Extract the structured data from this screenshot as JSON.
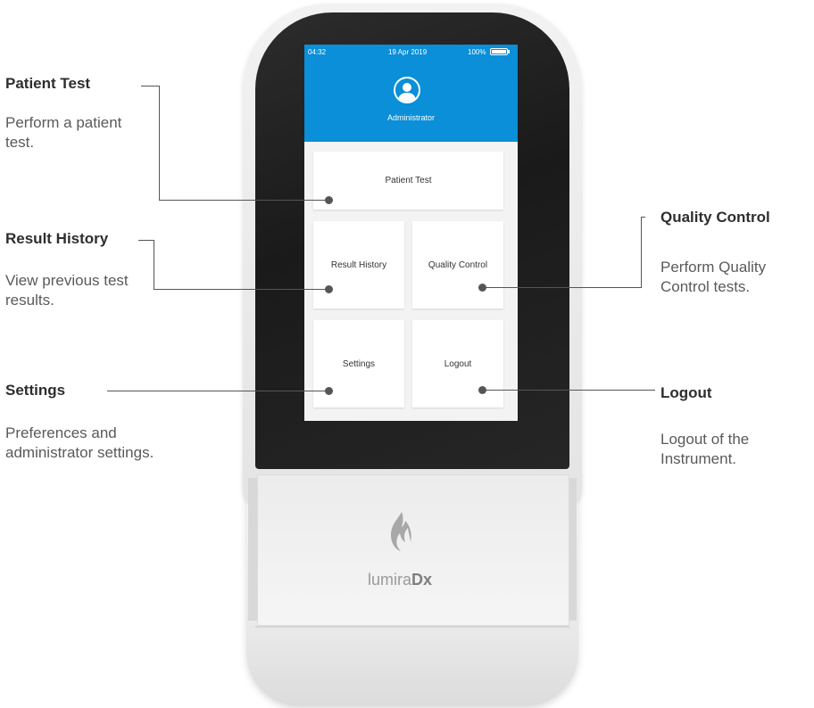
{
  "screen": {
    "status_bar": {
      "time": "04:32",
      "date": "19 Apr 2019",
      "battery": "100%"
    },
    "battery_level": 1.0,
    "user": {
      "name": "Administrator",
      "icon": "user-avatar-icon"
    },
    "tiles": {
      "patient_test": "Patient Test",
      "result_history": "Result History",
      "quality_control": "Quality Control",
      "settings": "Settings",
      "logout": "Logout"
    },
    "header_color": "#0a8fd8"
  },
  "callouts": {
    "patient_test": {
      "title": "Patient Test",
      "desc": "Perform a patient test."
    },
    "result_history": {
      "title": "Result History",
      "desc": "View previous test results."
    },
    "settings": {
      "title": "Settings",
      "desc": "Preferences and administrator settings."
    },
    "quality_control": {
      "title": "Quality Control",
      "desc": "Perform Quality Control tests."
    },
    "logout": {
      "title": "Logout",
      "desc": "Logout of the Instrument."
    }
  },
  "device": {
    "logo_light": "lumira",
    "logo_bold": "Dx",
    "logo_icon": "flame-logo-icon"
  }
}
